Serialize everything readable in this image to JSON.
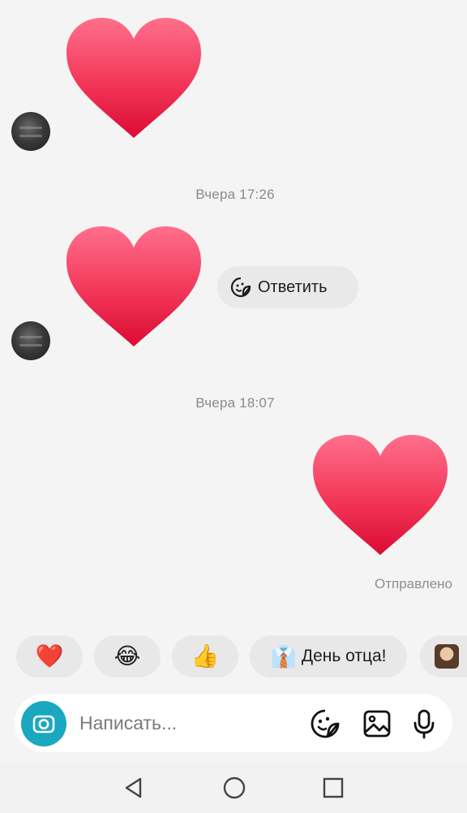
{
  "messages": {
    "timestamp_1": "Вчера 17:26",
    "timestamp_2": "Вчера 18:07",
    "reply_label": "Ответить",
    "sent_status": "Отправлено"
  },
  "quick_replies": {
    "heart_emoji": "❤️",
    "laugh_emoji": "😂",
    "thumbs_emoji": "👍",
    "fathers_day_emoji": "👔",
    "fathers_day_label": "День отца!"
  },
  "composer": {
    "placeholder": "Написать..."
  },
  "colors": {
    "heart_top": "#ff5a7a",
    "heart_bottom": "#e0103a",
    "camera_accent": "#1aa8c0"
  },
  "icons": {
    "reply": "sticker-reply-icon",
    "sticker": "sticker-icon",
    "gallery": "gallery-icon",
    "mic": "microphone-icon",
    "camera": "camera-icon",
    "nav_back": "back-triangle-icon",
    "nav_home": "home-circle-icon",
    "nav_recents": "recents-square-icon"
  }
}
